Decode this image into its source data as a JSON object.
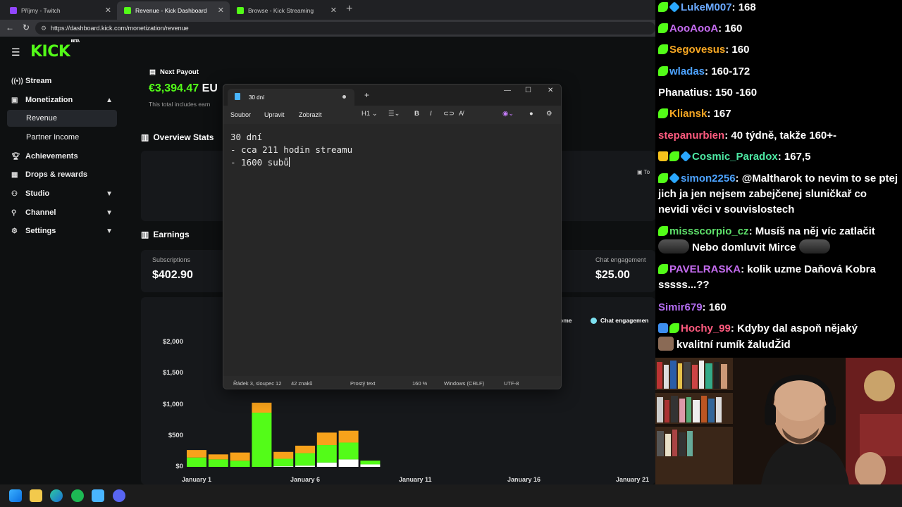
{
  "browser": {
    "tabs": [
      {
        "title": "Příjmy - Twitch",
        "favicon_color": "#9146ff"
      },
      {
        "title": "Revenue - Kick Dashboard",
        "favicon_color": "#53fc18"
      },
      {
        "title": "Browse - Kick Streaming",
        "favicon_color": "#53fc18"
      }
    ],
    "url": "https://dashboard.kick.com/monetization/revenue"
  },
  "kick": {
    "logo": "KICK",
    "logo_badge": "BETA",
    "sidebar": [
      {
        "label": "Stream",
        "icon": "broadcast-icon"
      },
      {
        "label": "Monetization",
        "icon": "money-icon"
      },
      {
        "label": "Revenue"
      },
      {
        "label": "Partner Income"
      },
      {
        "label": "Achievements",
        "icon": "trophy-icon"
      },
      {
        "label": "Drops & rewards",
        "icon": "gift-icon"
      },
      {
        "label": "Studio",
        "icon": "studio-icon"
      },
      {
        "label": "Channel",
        "icon": "channel-icon"
      },
      {
        "label": "Settings",
        "icon": "gear-icon"
      }
    ],
    "next_payout": {
      "title": "Next Payout",
      "amount": "€3,394.47",
      "currency_fragment": "EU",
      "note": "This total includes earn"
    },
    "overview_title": "Overview Stats",
    "overview_fragment": "To",
    "earnings_title": "Earnings",
    "subscriptions": {
      "label": "Subscriptions",
      "value": "$402.90"
    },
    "chat_engagement": {
      "label": "Chat engagement",
      "value": "$25.00"
    },
    "legend": {
      "income_fragment": "ome",
      "chat_engagement": "Chat engagemen"
    },
    "colors": {
      "accent": "#53fc18",
      "orange": "#f7a21b",
      "white": "#ffffff"
    }
  },
  "chart_data": {
    "type": "bar",
    "stacked": true,
    "y_ticks": [
      "$2,000",
      "$1,500",
      "$1,000",
      "$500",
      "$0"
    ],
    "x_ticks": [
      "January 1",
      "January 6",
      "January 11",
      "January 16",
      "January 21"
    ],
    "ylim": [
      0,
      2000
    ],
    "bars": [
      {
        "green": 150,
        "orange": 120,
        "white": 0
      },
      {
        "green": 120,
        "orange": 80,
        "white": 0
      },
      {
        "green": 100,
        "orange": 130,
        "white": 0
      },
      {
        "green": 870,
        "orange": 160,
        "white": 0
      },
      {
        "green": 120,
        "orange": 110,
        "white": 10
      },
      {
        "green": 200,
        "orange": 120,
        "white": 20
      },
      {
        "green": 280,
        "orange": 200,
        "white": 70
      },
      {
        "green": 270,
        "orange": 190,
        "white": 120
      },
      {
        "green": 60,
        "orange": 0,
        "white": 40
      }
    ]
  },
  "notepad": {
    "tab_title": "30 dní",
    "menus": [
      "Soubor",
      "Upravit",
      "Zobrazit"
    ],
    "heading_tool": "H1",
    "lines": [
      "30 dní",
      "- cca 211 hodin streamu",
      "- 1600 subů"
    ],
    "status": {
      "position": "Řádek 3, sloupec 12",
      "chars": "42 znaků",
      "format": "Prostý text",
      "zoom": "160 %",
      "eol": "Windows (CRLF)",
      "encoding": "UTF-8"
    }
  },
  "chat": {
    "messages": [
      {
        "badges": [
          "green",
          "blue"
        ],
        "user": "LukeM007",
        "color": "#6aa9ff",
        "text": "168"
      },
      {
        "badges": [
          "green"
        ],
        "user": "AooAooA",
        "color": "#c56cf0",
        "text": "160"
      },
      {
        "badges": [
          "green"
        ],
        "user": "Segovesus",
        "color": "#f5a623",
        "text": "160"
      },
      {
        "badges": [
          "green"
        ],
        "user": "wladas",
        "color": "#4da3ff",
        "text": "160-172"
      },
      {
        "badges": [],
        "user": "Phanatius",
        "color": "#ffffff",
        "text": "150 -160"
      },
      {
        "badges": [
          "green"
        ],
        "user": "Kliansk",
        "color": "#f5a623",
        "text": "167"
      },
      {
        "badges": [],
        "user": "stepanurbien",
        "color": "#ff5b7f",
        "text": "40 týdně, takže 160+-"
      },
      {
        "badges": [
          "crown",
          "green",
          "blue"
        ],
        "user": "Cosmic_Paradox",
        "color": "#4de8a3",
        "text": "167,5"
      },
      {
        "badges": [
          "green",
          "blue"
        ],
        "user": "simon2256",
        "color": "#4da3ff",
        "text": "@Maltharok to nevim to se ptej jich ja jen nejsem zabejčenej sluničkař co nevidi věci v souvislostech"
      },
      {
        "badges": [
          "green"
        ],
        "user": "missscorpio_cz",
        "color": "#5ee06a",
        "text": "Musíš na něj víc zatlačit",
        "text2": "Nebo domluvit Mirce"
      },
      {
        "badges": [
          "green"
        ],
        "user": "PAVELRASKA",
        "color": "#c56cf0",
        "text": "kolik uzme Daňová Kobra sssss...??"
      },
      {
        "badges": [],
        "user": "Simir679",
        "color": "#b36cf0",
        "text": "160"
      },
      {
        "badges": [
          "arrow",
          "green"
        ],
        "user": "Hochy_99",
        "color": "#ff5b7f",
        "text": "Kdyby dal aspoň nějaký",
        "text2": "kvalitní rumík žaludŽid"
      }
    ]
  },
  "taskbar": {
    "icons": [
      "windows-start-icon",
      "file-explorer-icon",
      "edge-icon",
      "spotify-icon",
      "notepad-icon",
      "discord-icon"
    ]
  }
}
